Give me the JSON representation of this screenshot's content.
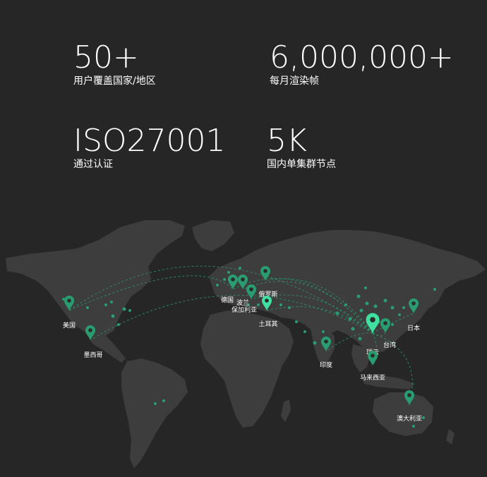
{
  "stats": [
    {
      "value": "50+",
      "label": "用户覆盖国家/地区"
    },
    {
      "value": "6,000,000+",
      "label": "每月渲染帧"
    },
    {
      "value": "ISO27001",
      "label": "通过认证"
    },
    {
      "value": "5K",
      "label": "国内单集群节点"
    }
  ],
  "map": {
    "accent_color": "#2a9c71",
    "highlight_color": "#3fe0a0",
    "locations": [
      {
        "label": "美国",
        "icon": "map-pin-icon"
      },
      {
        "label": "墨西哥",
        "icon": "map-pin-icon"
      },
      {
        "label": "德国",
        "icon": "map-pin-icon"
      },
      {
        "label": "波兰",
        "icon": "map-pin-icon"
      },
      {
        "label": "保加利亚",
        "icon": "map-pin-icon"
      },
      {
        "label": "俄罗斯",
        "icon": "map-pin-icon"
      },
      {
        "label": "土耳其",
        "icon": "map-pin-icon"
      },
      {
        "label": "印度",
        "icon": "map-pin-icon"
      },
      {
        "label": "瑞云",
        "icon": "map-pin-icon"
      },
      {
        "label": "台湾",
        "icon": "map-pin-icon"
      },
      {
        "label": "日本",
        "icon": "map-pin-icon"
      },
      {
        "label": "马来西亚",
        "icon": "map-pin-icon"
      },
      {
        "label": "澳大利亚",
        "icon": "map-pin-icon"
      }
    ]
  }
}
